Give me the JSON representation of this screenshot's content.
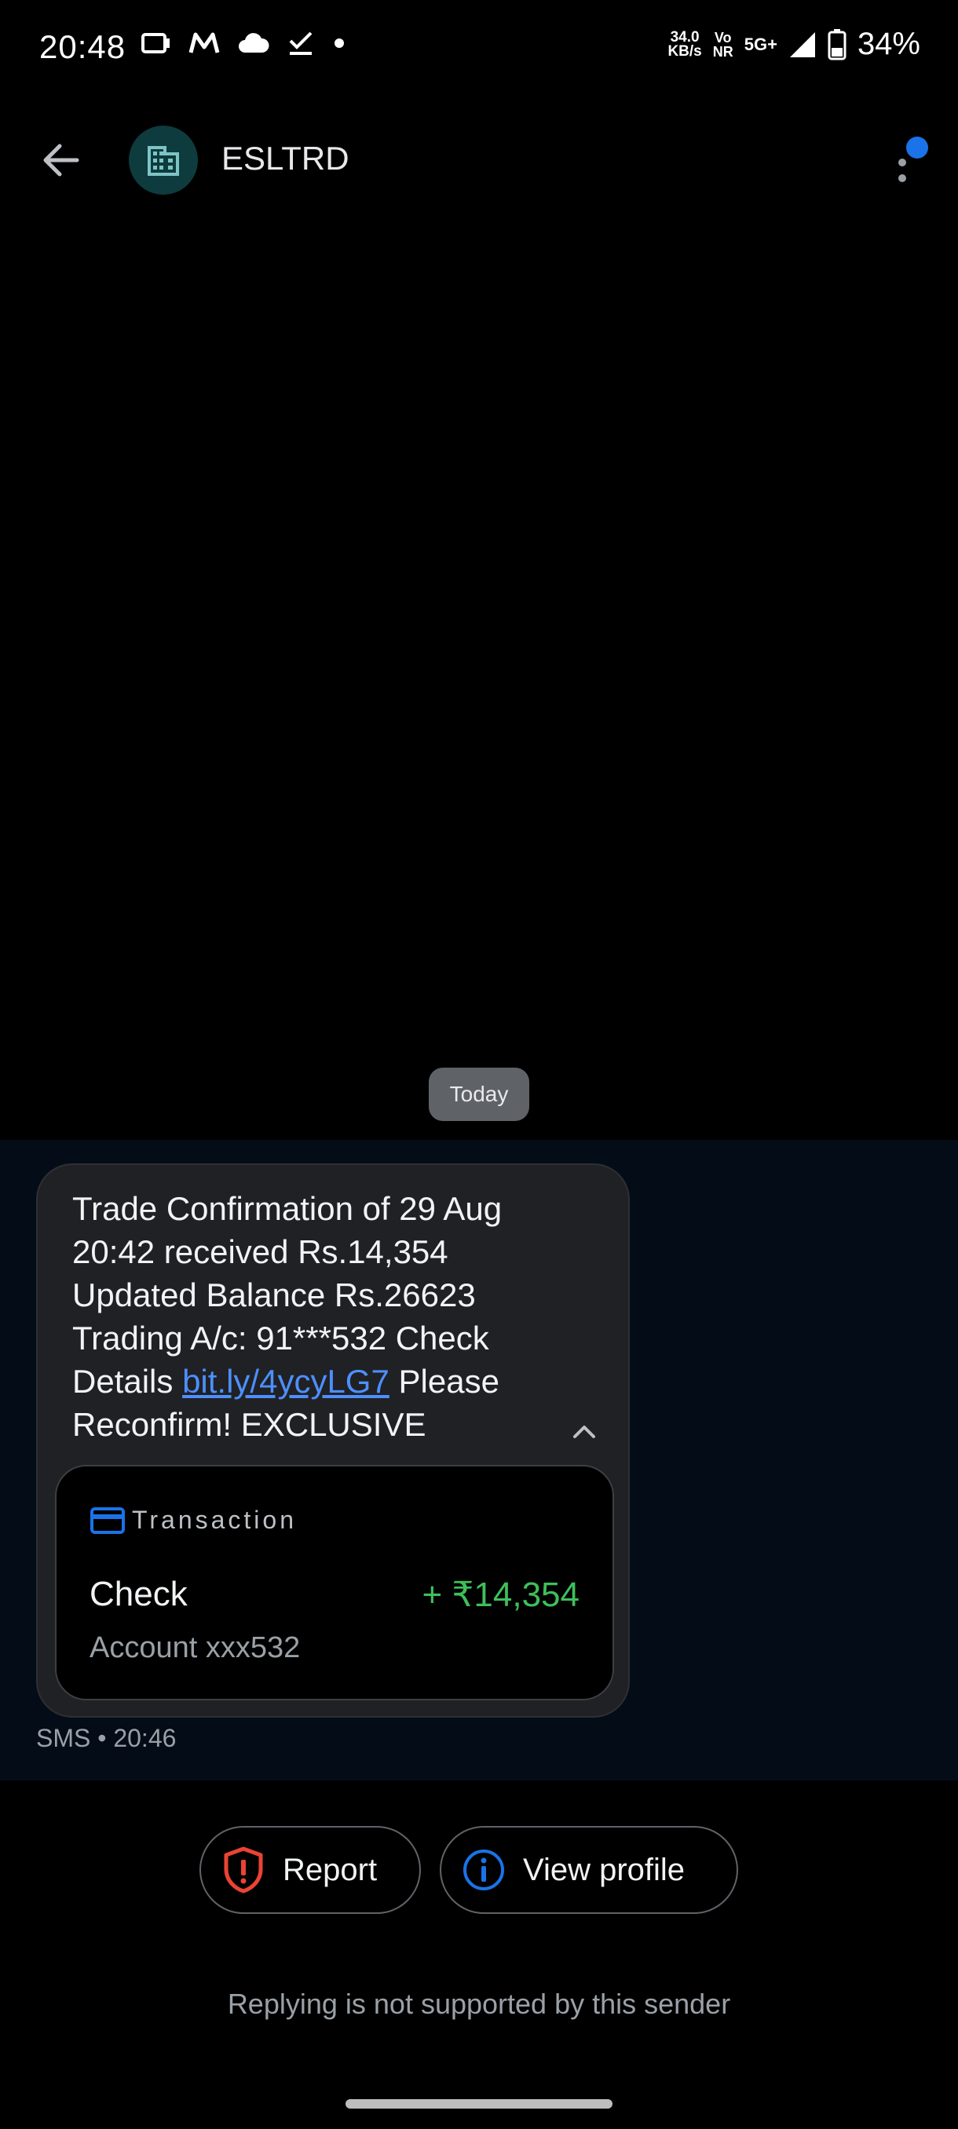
{
  "status_bar": {
    "time": "20:48",
    "speed_value": "34.0",
    "speed_unit": "KB/s",
    "volte_top": "Vo",
    "volte_bottom": "NR",
    "network": "5G+",
    "battery": "34%",
    "icons_left": [
      "screen-record-icon",
      "m-app-icon",
      "cloud-icon",
      "check-icon",
      "dot-icon"
    ]
  },
  "app_bar": {
    "sender": "ESLTRD",
    "avatar_icon": "building-icon",
    "accent": "#1a73e8"
  },
  "thread": {
    "date_chip": "Today",
    "message": {
      "line1": "Trade Confirmation of 29 Aug",
      "line2": "20:42 received Rs.14,354",
      "line3": "Updated Balance Rs.26623",
      "line4": "Trading A/c: 91***532 Check",
      "line5_prefix": "Details ",
      "link": "bit.ly/4ycyLG7",
      "line5_suffix": " Please",
      "line6": "Reconfirm! EXCLUSIVE"
    },
    "card": {
      "label": "Transaction",
      "title": "Check",
      "amount": "+ ₹14,354",
      "account": "Account xxx532",
      "amount_color": "#3fbf5a"
    },
    "meta": "SMS • 20:46"
  },
  "actions": {
    "report": "Report",
    "view_profile": "View profile"
  },
  "footer_note": "Replying is not supported by this sender"
}
